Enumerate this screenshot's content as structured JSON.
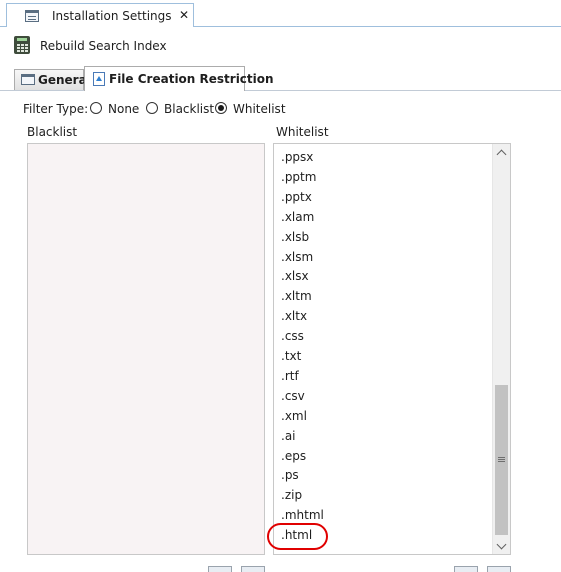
{
  "document_tab": {
    "title": "Installation Settings",
    "close_glyph": "✕",
    "icon": "settings-window-icon"
  },
  "toolbar": {
    "rebuild_label": "Rebuild Search Index",
    "icon": "calculator-icon"
  },
  "tabs": [
    {
      "label": "General",
      "icon": "window-icon",
      "selected": false
    },
    {
      "label": "File Creation Restriction",
      "icon": "upload-file-icon",
      "selected": true
    }
  ],
  "filter": {
    "label": "Filter Type:",
    "options": [
      {
        "label": "None",
        "selected": false
      },
      {
        "label": "Blacklist",
        "selected": false
      },
      {
        "label": "Whitelist",
        "selected": true
      }
    ]
  },
  "blacklist": {
    "header": "Blacklist",
    "items": []
  },
  "whitelist": {
    "header": "Whitelist",
    "items": [
      ".ppsx",
      ".pptm",
      ".pptx",
      ".xlam",
      ".xlsb",
      ".xlsm",
      ".xlsx",
      ".xltm",
      ".xltx",
      ".css",
      ".txt",
      ".rtf",
      ".csv",
      ".xml",
      ".ai",
      ".eps",
      ".ps",
      ".zip",
      ".mhtml",
      ".html"
    ],
    "highlighted_item": ".html",
    "highlight_color": "#e00000"
  },
  "colors": {
    "tab_border": "#9fbfdd",
    "blacklist_bg": "#f8f3f4"
  }
}
